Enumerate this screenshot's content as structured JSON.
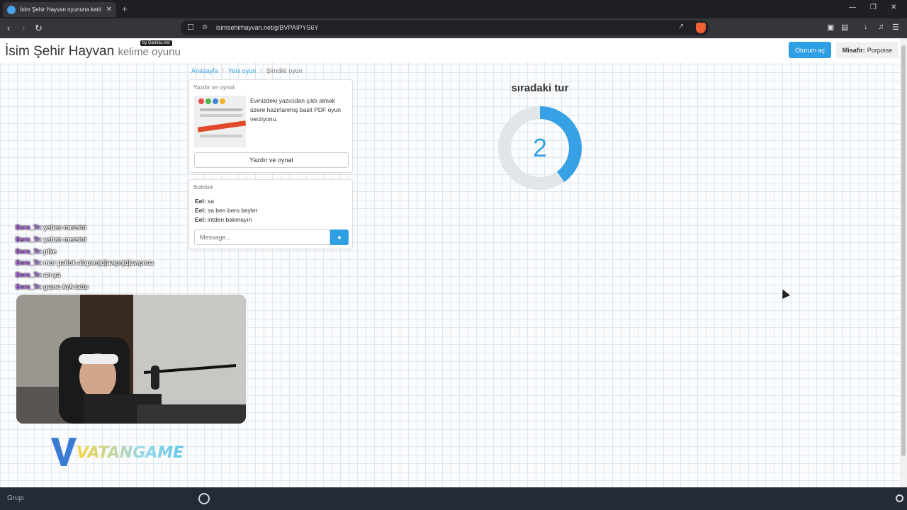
{
  "browser": {
    "tab_title": "İsim Şehir Hayvan oyununa katıl",
    "tab_close": "✕",
    "new_tab": "+",
    "url": "isimsehirhayvan.net/g/BVPAIPYS6Y",
    "window_controls": [
      "—",
      "❐",
      "✕"
    ]
  },
  "site": {
    "brand": "İsim Şehir Hayvan",
    "brand_sub": "kelime oyunu",
    "by_badge": "by Gamiac.net",
    "login_button": "Oturum aç",
    "guest_label": "Misafir:",
    "guest_name": "Porpoise"
  },
  "breadcrumb": {
    "home": "Anasayfa",
    "new_game": "Yeni oyun",
    "current": "Şimdiki oyun"
  },
  "print_panel": {
    "heading": "Yazdır ve oynat",
    "description": "Evinizdeki yazıcıdan çıktı almak üzere hazırlanmış basit PDF oyun verziyonu.",
    "button": "Yazdır ve oynat"
  },
  "chat_panel": {
    "heading": "Sohbet",
    "messages": [
      {
        "user": "Eel:",
        "text": "sa"
      },
      {
        "user": "Eel:",
        "text": "sa ben bero beyler"
      },
      {
        "user": "Eel:",
        "text": "intden bakmayın"
      }
    ],
    "input_placeholder": "Message..."
  },
  "round": {
    "label": "sıradaki tur",
    "countdown": "2",
    "progress_fraction": 0.4,
    "accent_color": "#37a1e6",
    "track_color": "#e1e6ea"
  },
  "stream_overlay": {
    "chat": [
      {
        "name": "Bero_Tr:",
        "text": "yaban mersini"
      },
      {
        "name": "Bero_Tr:",
        "text": "yaban mersini"
      },
      {
        "name": "Bero_Tr:",
        "text": "pike"
      },
      {
        "name": "Bero_Tr:",
        "text": "mor pallok alapwnjdjawpnjdjawpnaa"
      },
      {
        "name": "Bero_Tr:",
        "text": "arı ya"
      },
      {
        "name": "Bero_Tr:",
        "text": "game ArA tatte"
      }
    ],
    "logo_text": "VATANGAME"
  },
  "taskbar": {
    "group_label": "Grup:"
  }
}
